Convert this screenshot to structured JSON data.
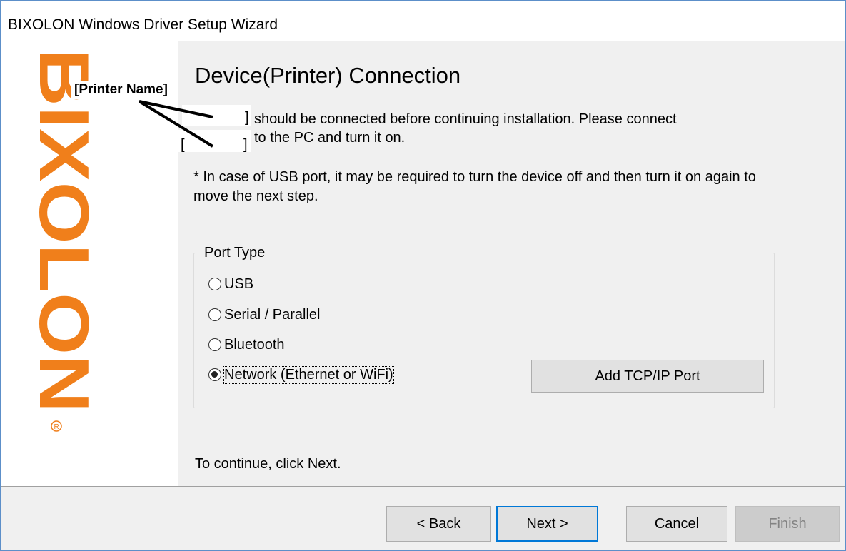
{
  "window": {
    "title": "BIXOLON Windows Driver Setup Wizard"
  },
  "sidebar": {
    "logo_text": "BIXOLON",
    "logo_color": "#f07f1b",
    "registered_mark": "®"
  },
  "main": {
    "heading": "Device(Printer) Connection",
    "annotation_label": "[Printer Name]",
    "line1_bracket": "]",
    "line1_text": "should be connected before continuing installation. Please connect",
    "line2_bracket_open": "[",
    "line2_bracket_close": "]",
    "line2_text": "to the PC and turn it on.",
    "note": "* In case of USB port, it may be required to turn the device off and then turn it on again to move the next step.",
    "port_group": {
      "legend": "Port Type",
      "options": [
        {
          "label": "USB",
          "checked": false
        },
        {
          "label": "Serial / Parallel",
          "checked": false
        },
        {
          "label": "Bluetooth",
          "checked": false
        },
        {
          "label": "Network (Ethernet or WiFi)",
          "checked": true
        }
      ],
      "add_port_button": "Add TCP/IP Port"
    },
    "continue_text": "To continue, click Next."
  },
  "footer": {
    "back_label": "< Back",
    "next_label": "Next >",
    "cancel_label": "Cancel",
    "finish_label": "Finish"
  }
}
